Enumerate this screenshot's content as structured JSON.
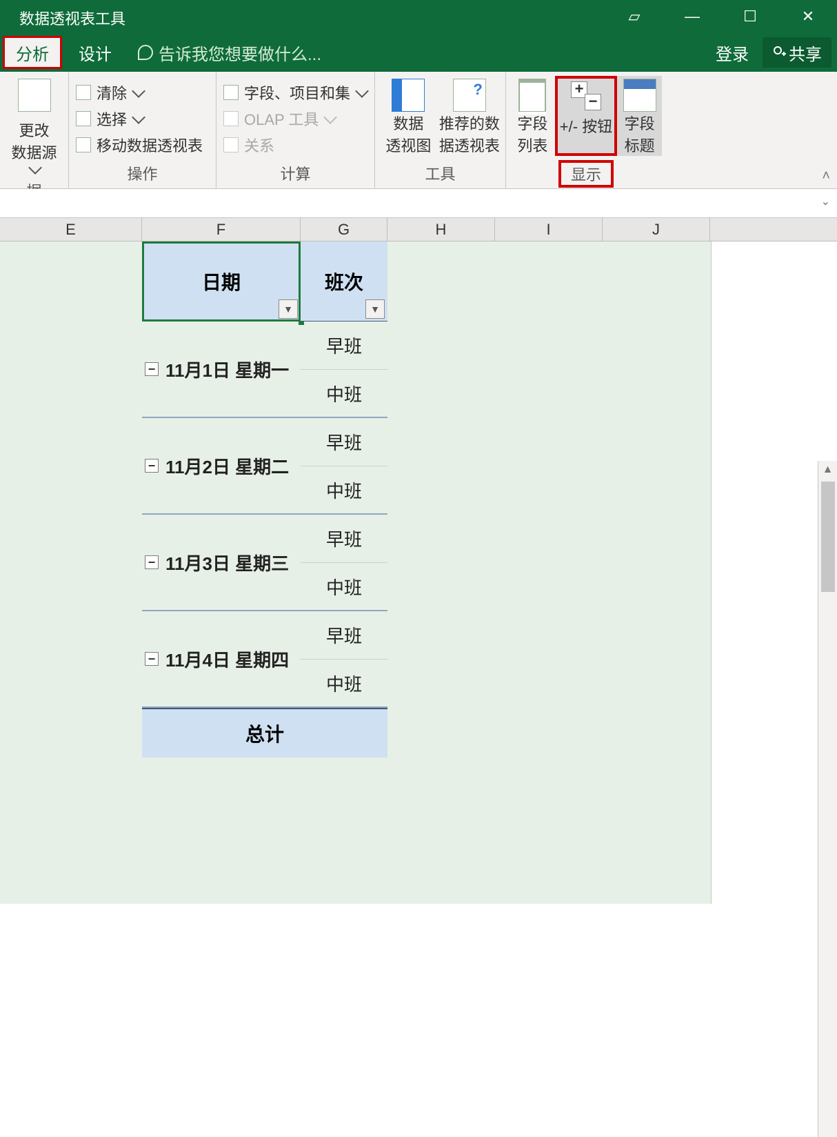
{
  "window": {
    "title": "数据透视表工具",
    "login": "登录",
    "share": "共享"
  },
  "tabs": {
    "analyze": "分析",
    "design": "设计",
    "tellme": "告诉我您想要做什么..."
  },
  "ribbon": {
    "g_data": {
      "label": "据",
      "change_source": "更改\n数据源"
    },
    "g_ops": {
      "label": "操作",
      "clear": "清除",
      "select": "选择",
      "move": "移动数据透视表"
    },
    "g_calc": {
      "label": "计算",
      "fields": "字段、项目和集",
      "olap": "OLAP 工具",
      "rel": "关系"
    },
    "g_tools": {
      "label": "工具",
      "pchart": "数据\n透视图",
      "recpivot": "推荐的数\n据透视表"
    },
    "g_show": {
      "label": "显示",
      "fieldlist": "字段\n列表",
      "plusminus": "+/- 按钮",
      "headers": "字段\n标题"
    }
  },
  "columns": {
    "E": "E",
    "F": "F",
    "G": "G",
    "H": "H",
    "I": "I",
    "J": "J"
  },
  "pivot": {
    "header_date": "日期",
    "header_shift": "班次",
    "rows": [
      {
        "date": "11月1日  星期一",
        "shifts": [
          "早班",
          "中班"
        ]
      },
      {
        "date": "11月2日  星期二",
        "shifts": [
          "早班",
          "中班"
        ]
      },
      {
        "date": "11月3日  星期三",
        "shifts": [
          "早班",
          "中班"
        ]
      },
      {
        "date": "11月4日  星期四",
        "shifts": [
          "早班",
          "中班"
        ]
      }
    ],
    "total": "总计",
    "collapse_glyph": "⊟"
  }
}
